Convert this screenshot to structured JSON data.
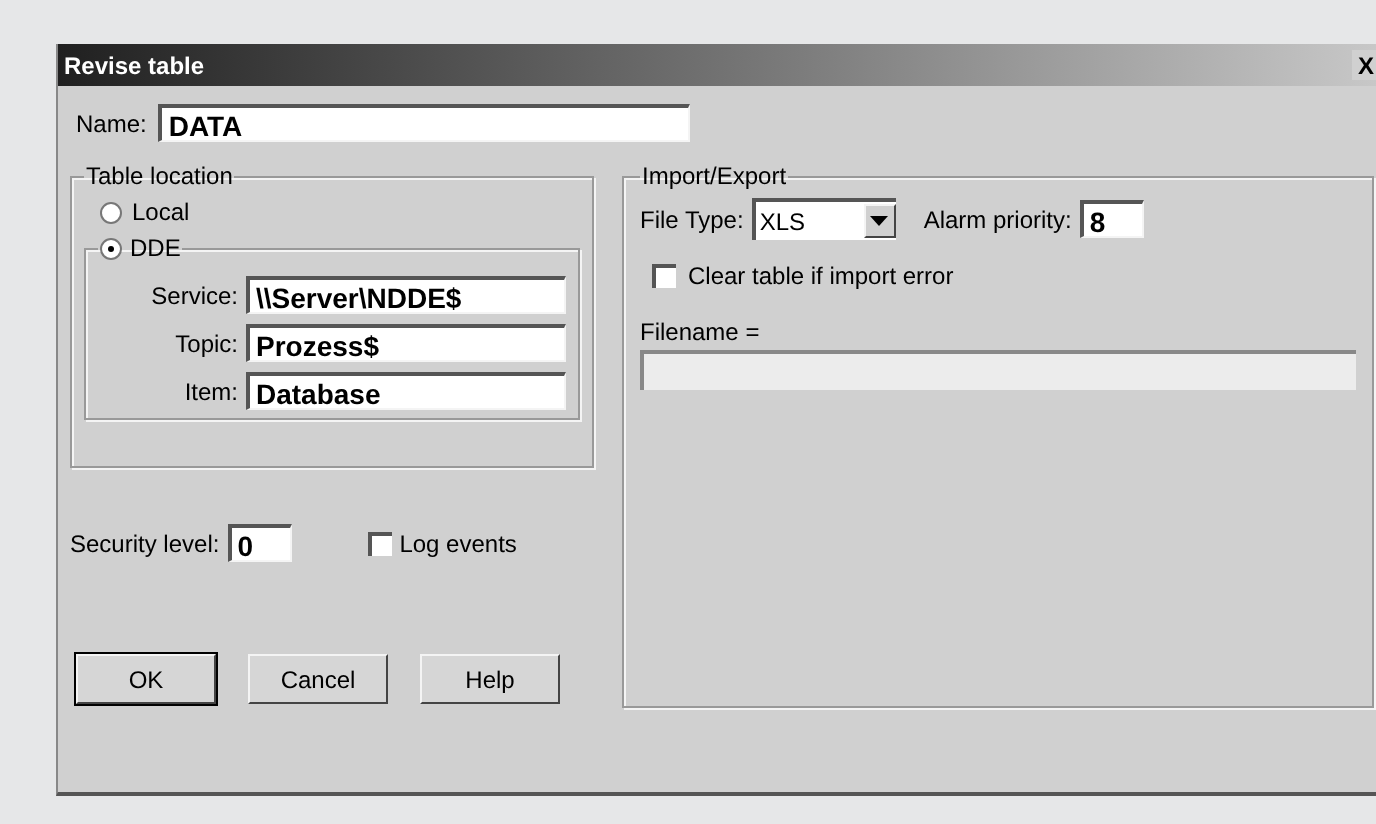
{
  "window": {
    "title": "Revise table",
    "close": "X"
  },
  "name": {
    "label": "Name:",
    "value": "DATA"
  },
  "table_location": {
    "title": "Table location",
    "options": [
      {
        "label": "Local",
        "selected": false
      },
      {
        "label": "DDE",
        "selected": true
      }
    ],
    "fields": [
      {
        "label": "Service:",
        "value": "\\\\Server\\NDDE$"
      },
      {
        "label": "Topic:",
        "value": "Prozess$"
      },
      {
        "label": "Item:",
        "value": "Database"
      }
    ]
  },
  "security_level": {
    "label": "Security level:",
    "value": "0"
  },
  "log_events": {
    "label": "Log events",
    "checked": false
  },
  "buttons": [
    "OK",
    "Cancel",
    "Help"
  ],
  "import_export": {
    "title": "Import/Export",
    "file_type": {
      "label": "File Type:",
      "value": "XLS"
    },
    "alarm_priority": {
      "label": "Alarm priority:",
      "value": "8"
    },
    "clear_table": {
      "label": "Clear table if import error",
      "checked": false
    },
    "filename": {
      "label": "Filename ="
    }
  }
}
